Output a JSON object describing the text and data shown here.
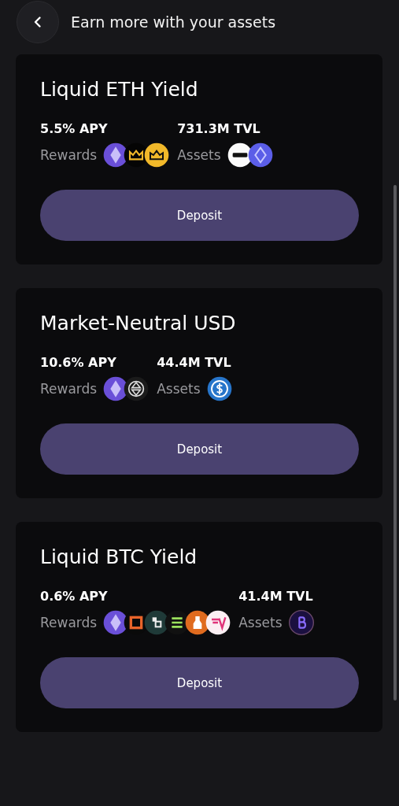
{
  "header": {
    "title": "Earn more with your assets"
  },
  "vaults": [
    {
      "name": "Liquid ETH Yield",
      "apy": "5.5% APY",
      "tvl": "731.3M TVL",
      "rewards_label": "Rewards",
      "assets_label": "Assets",
      "rewards": [
        {
          "kind": "eth"
        },
        {
          "kind": "crown-dark"
        },
        {
          "kind": "crown-gold"
        }
      ],
      "assets": [
        {
          "kind": "wet"
        },
        {
          "kind": "eth-blue"
        }
      ],
      "button": "Deposit"
    },
    {
      "name": "Market-Neutral USD",
      "apy": "10.6% APY",
      "tvl": "44.4M TVL",
      "rewards_label": "Rewards",
      "assets_label": "Assets",
      "rewards": [
        {
          "kind": "eth"
        },
        {
          "kind": "swap"
        }
      ],
      "assets": [
        {
          "kind": "usdc"
        }
      ],
      "button": "Deposit"
    },
    {
      "name": "Liquid BTC Yield",
      "apy": "0.6% APY",
      "tvl": "41.4M TVL",
      "rewards_label": "Rewards",
      "assets_label": "Assets",
      "rewards": [
        {
          "kind": "eth"
        },
        {
          "kind": "orange-square"
        },
        {
          "kind": "blocks"
        },
        {
          "kind": "green-lines"
        },
        {
          "kind": "bottle"
        },
        {
          "kind": "pink-v"
        }
      ],
      "assets": [
        {
          "kind": "btc"
        }
      ],
      "button": "Deposit"
    }
  ]
}
